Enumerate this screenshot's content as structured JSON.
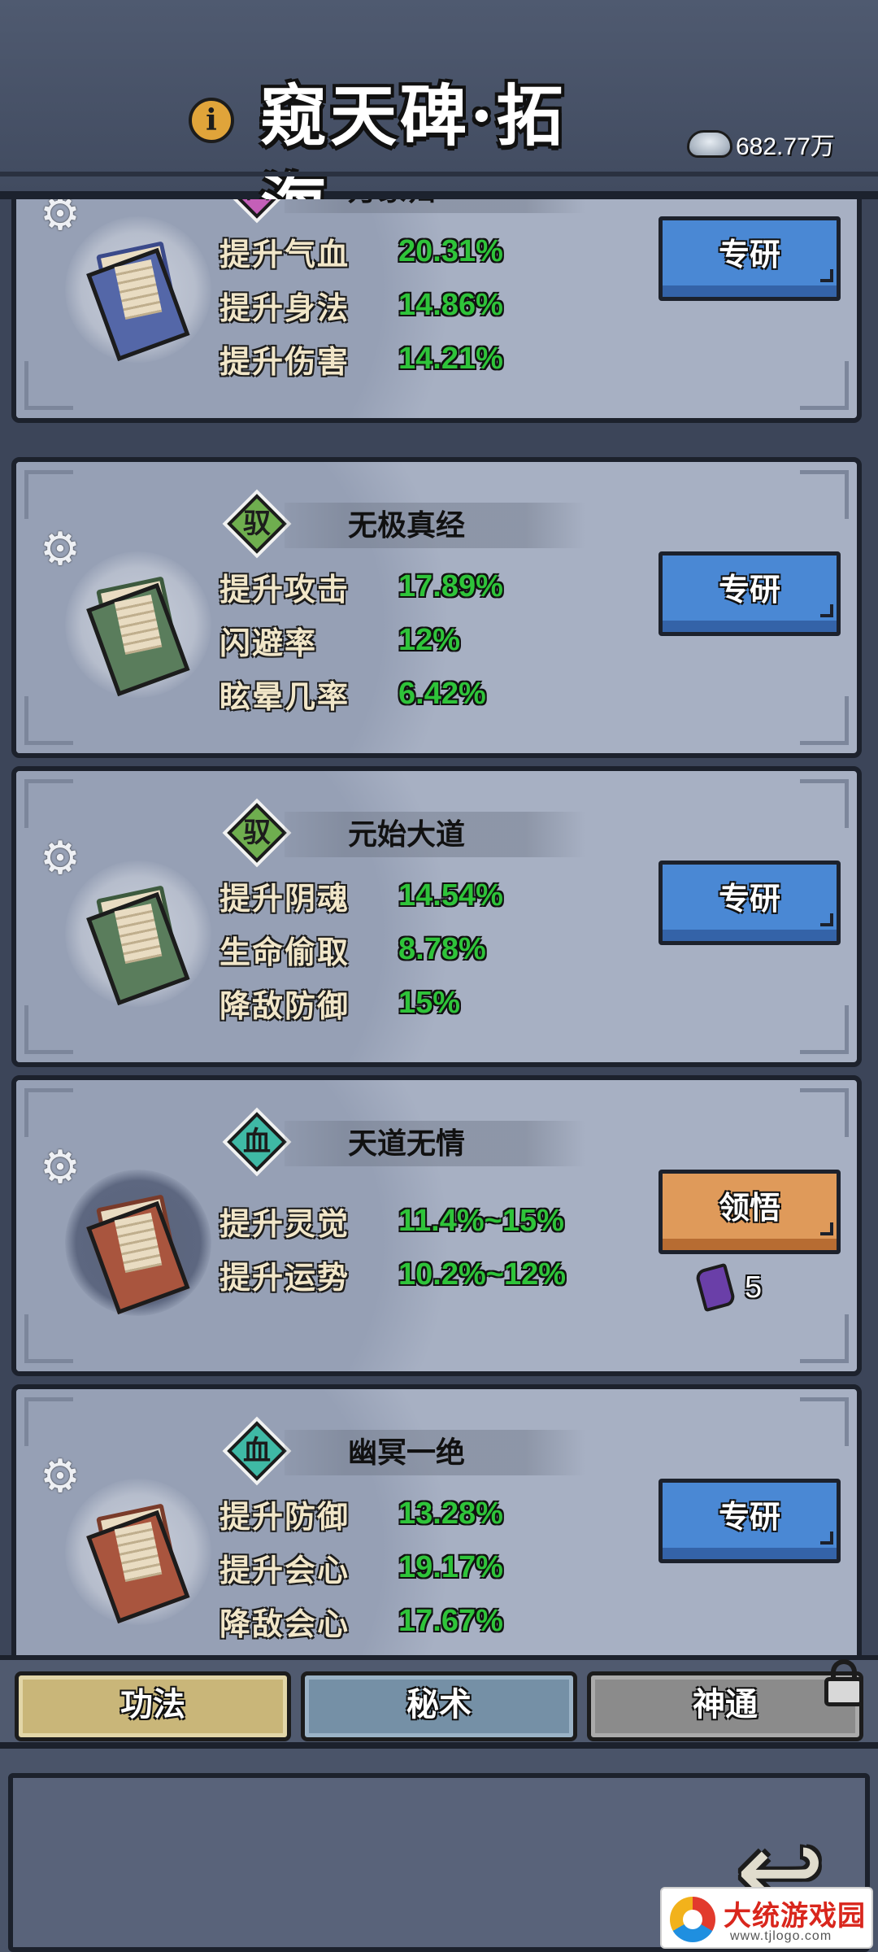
{
  "header": {
    "title": "窥天碑·拓海",
    "info_icon": "i",
    "currency_icon": "silver-ingot-icon",
    "currency_value": "682.77万"
  },
  "cards": [
    {
      "badge": "仙",
      "badge_color": "#c45fb8",
      "name": "万象归一",
      "scroll_color": "blue",
      "stats": [
        {
          "label": "提升气血",
          "value": "20.31%"
        },
        {
          "label": "提升身法",
          "value": "14.86%"
        },
        {
          "label": "提升伤害",
          "value": "14.21%"
        }
      ],
      "button": "专研"
    },
    {
      "badge": "驭",
      "badge_color": "#6fae4f",
      "name": "无极真经",
      "scroll_color": "green",
      "stats": [
        {
          "label": "提升攻击",
          "value": "17.89%"
        },
        {
          "label": "闪避率",
          "value": "12%"
        },
        {
          "label": "眩晕几率",
          "value": "6.42%"
        }
      ],
      "button": "专研"
    },
    {
      "badge": "驭",
      "badge_color": "#6fae4f",
      "name": "元始大道",
      "scroll_color": "green",
      "stats": [
        {
          "label": "提升阴魂",
          "value": "14.54%"
        },
        {
          "label": "生命偷取",
          "value": "8.78%"
        },
        {
          "label": "降敌防御",
          "value": "15%"
        }
      ],
      "button": "专研"
    },
    {
      "badge": "血",
      "badge_color": "#3fb9a5",
      "name": "天道无情",
      "scroll_color": "red",
      "stats": [
        {
          "label": "提升灵觉",
          "value": "11.4%~15%"
        },
        {
          "label": "提升运势",
          "value": "10.2%~12%"
        }
      ],
      "button": "领悟",
      "cost_icon": "purple-scroll-icon",
      "cost": "5"
    },
    {
      "badge": "血",
      "badge_color": "#3fb9a5",
      "name": "幽冥一绝",
      "scroll_color": "red",
      "stats": [
        {
          "label": "提升防御",
          "value": "13.28%"
        },
        {
          "label": "提升会心",
          "value": "19.17%"
        },
        {
          "label": "降敌会心",
          "value": "17.67%"
        }
      ],
      "button": "专研"
    }
  ],
  "tabs": {
    "active": "功法",
    "second": "秘术",
    "third": "神通"
  },
  "bottom": {
    "back_icon": "back-arrow-icon"
  },
  "watermark": {
    "name": "大统游戏园",
    "url": "www.tjlogo.com"
  }
}
